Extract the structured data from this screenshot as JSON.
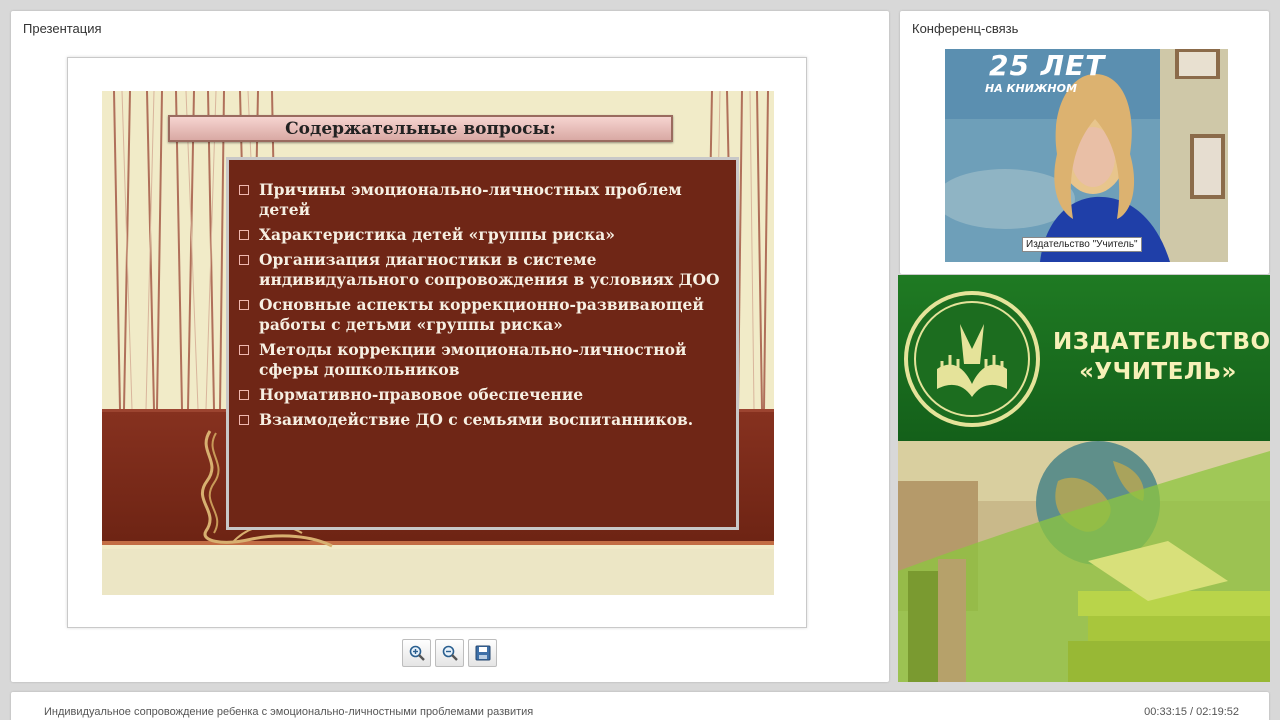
{
  "presentation": {
    "panel_title": "Презентация",
    "slide": {
      "title": "Содержательные вопросы:",
      "items": [
        "Причины эмоционально-личностных проблем детей",
        "Характеристика детей «группы риска»",
        "Организация диагностики в системе индивидуального сопровождения в условиях ДОО",
        "Основные аспекты коррекционно-развивающей работы с детьми «группы риска»",
        "Методы коррекции эмоционально-личностной сферы дошкольников",
        "Нормативно-правовое обеспечение",
        "Взаимодействие ДО с семьями воспитанников."
      ]
    },
    "toolbar": [
      "zoom-in-icon",
      "zoom-out-icon",
      "save-icon"
    ]
  },
  "conference": {
    "panel_title": "Конференц-связь",
    "video_label": "Издательство \"Учитель\"",
    "poster_text": "25 ЛЕТ",
    "poster_subtext": "НА КНИЖНОМ"
  },
  "ad": {
    "line1": "ИЗДАТЕЛЬСТВО",
    "line2": "«УЧИТЕЛЬ»"
  },
  "footer": {
    "lecture_title": "Индивидуальное сопровождение ребенка с эмоционально-личностными проблемами развития",
    "time_current": "00:33:15",
    "time_total": "02:19:52"
  },
  "colors": {
    "slide_box": "#6f2616",
    "ad_green": "#1f7a23",
    "ad_text": "#f7f1b8"
  }
}
